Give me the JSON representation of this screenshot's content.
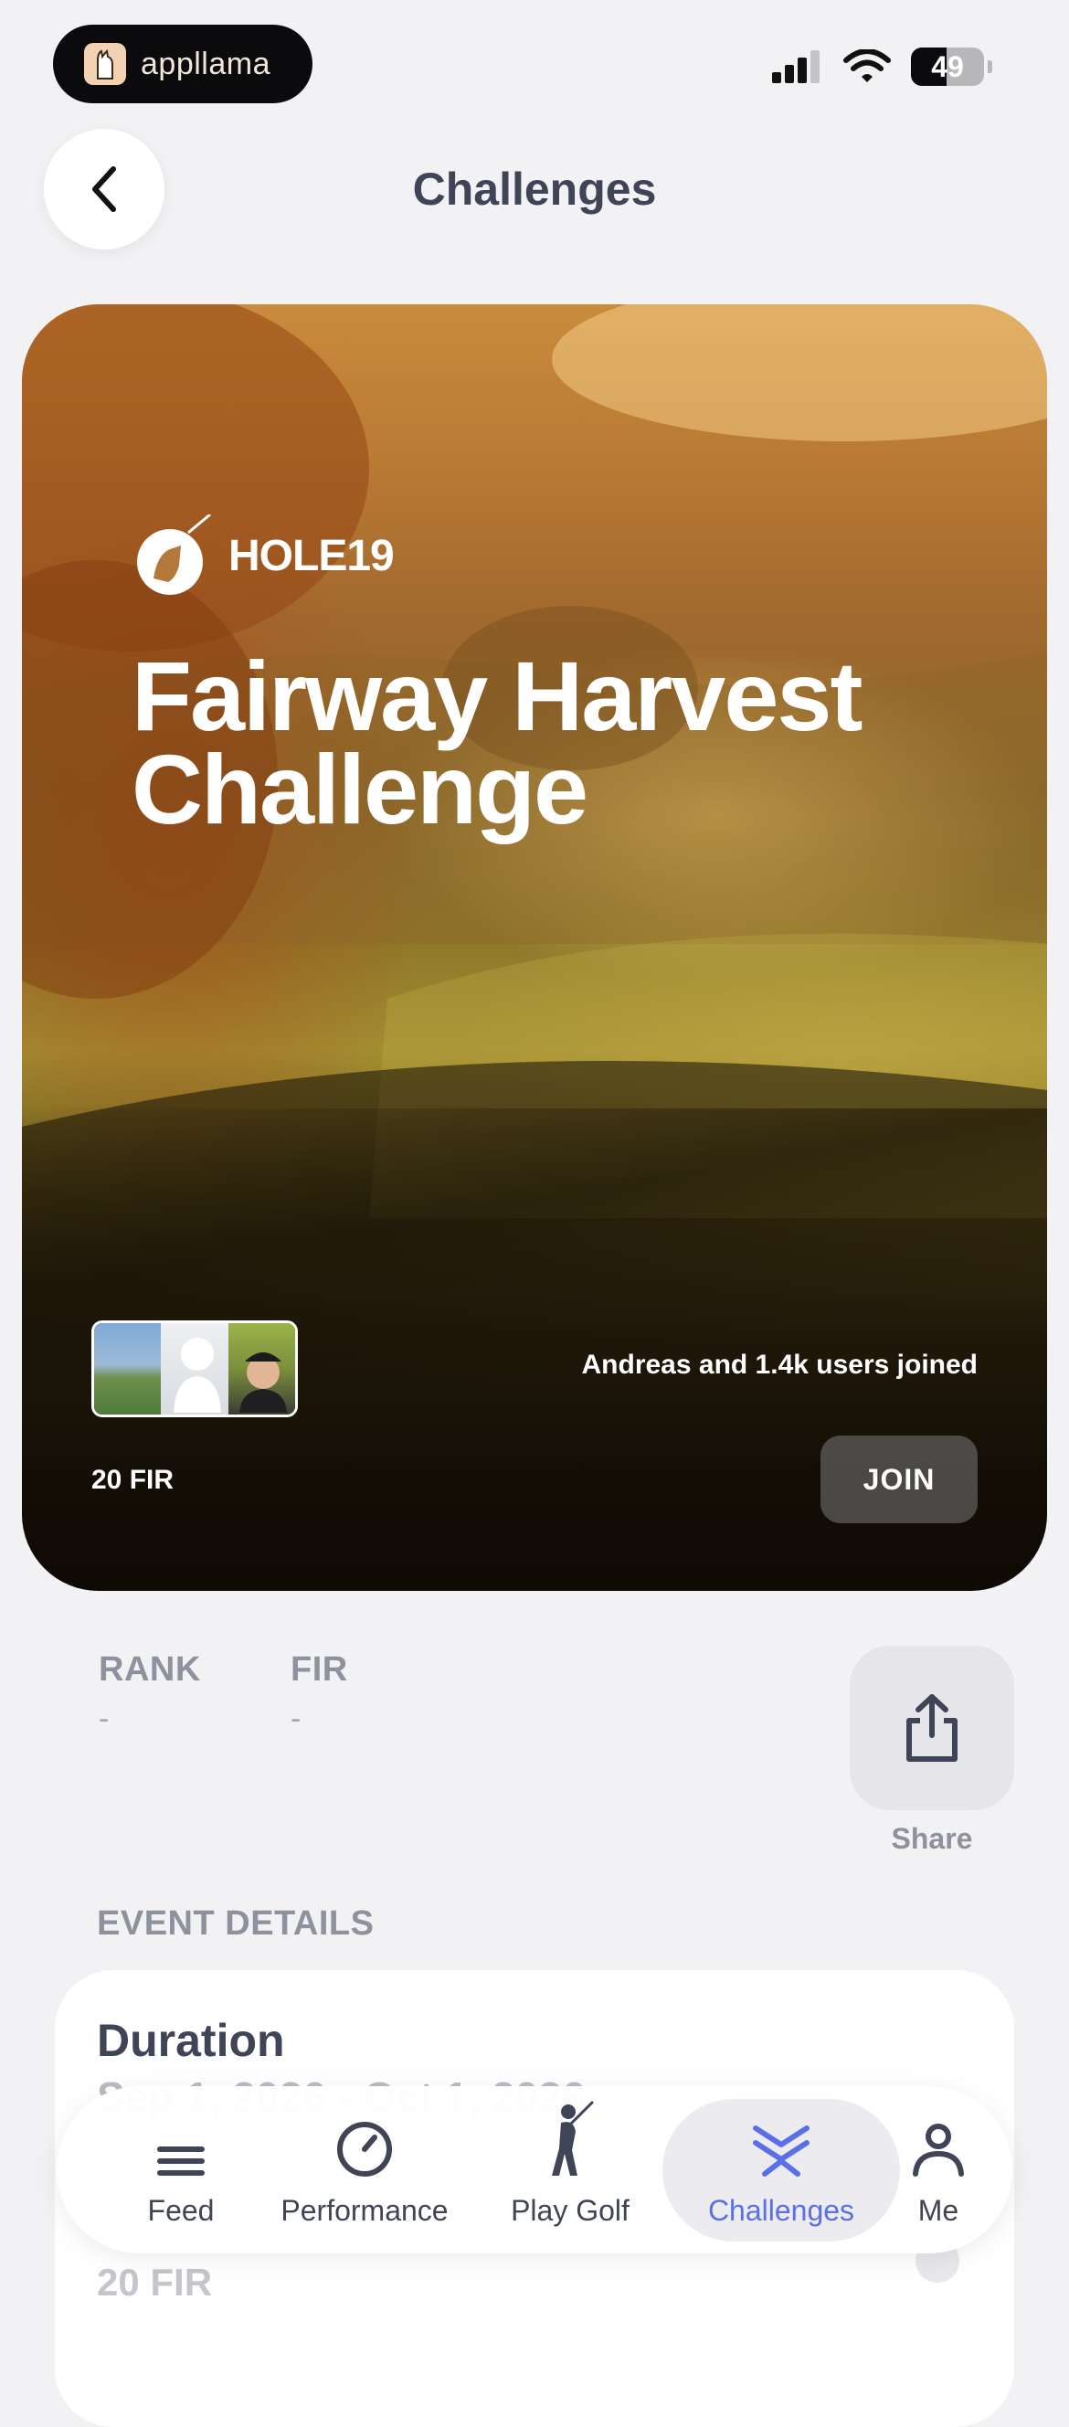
{
  "status_bar": {
    "app_badge": "appllama",
    "battery": "49",
    "battery_level_percent": 49
  },
  "header": {
    "title": "Challenges"
  },
  "hero": {
    "brand": "HOLE19",
    "title_line1": "Fairway Harvest",
    "title_line2": "Challenge",
    "joined_text": "Andreas and 1.4k users joined",
    "metric": "20 FIR",
    "join_label": "JOIN"
  },
  "stats": {
    "rank_label": "RANK",
    "rank_value": "-",
    "fir_label": "FIR",
    "fir_value": "-",
    "share_label": "Share"
  },
  "event_details": {
    "section_title": "EVENT DETAILS",
    "duration_label": "Duration",
    "duration_value": "Sep 1, 2026 - Oct 1, 2026",
    "goal_value": "20 FIR"
  },
  "tab_bar": {
    "items": [
      {
        "label": "Feed",
        "icon": "menu-lines-icon"
      },
      {
        "label": "Performance",
        "icon": "gauge-icon"
      },
      {
        "label": "Play Golf",
        "icon": "golfer-icon"
      },
      {
        "label": "Challenges",
        "icon": "chevrons-icon",
        "active": true
      },
      {
        "label": "Me",
        "icon": "person-icon"
      }
    ],
    "active_color": "#5b6fe6"
  }
}
